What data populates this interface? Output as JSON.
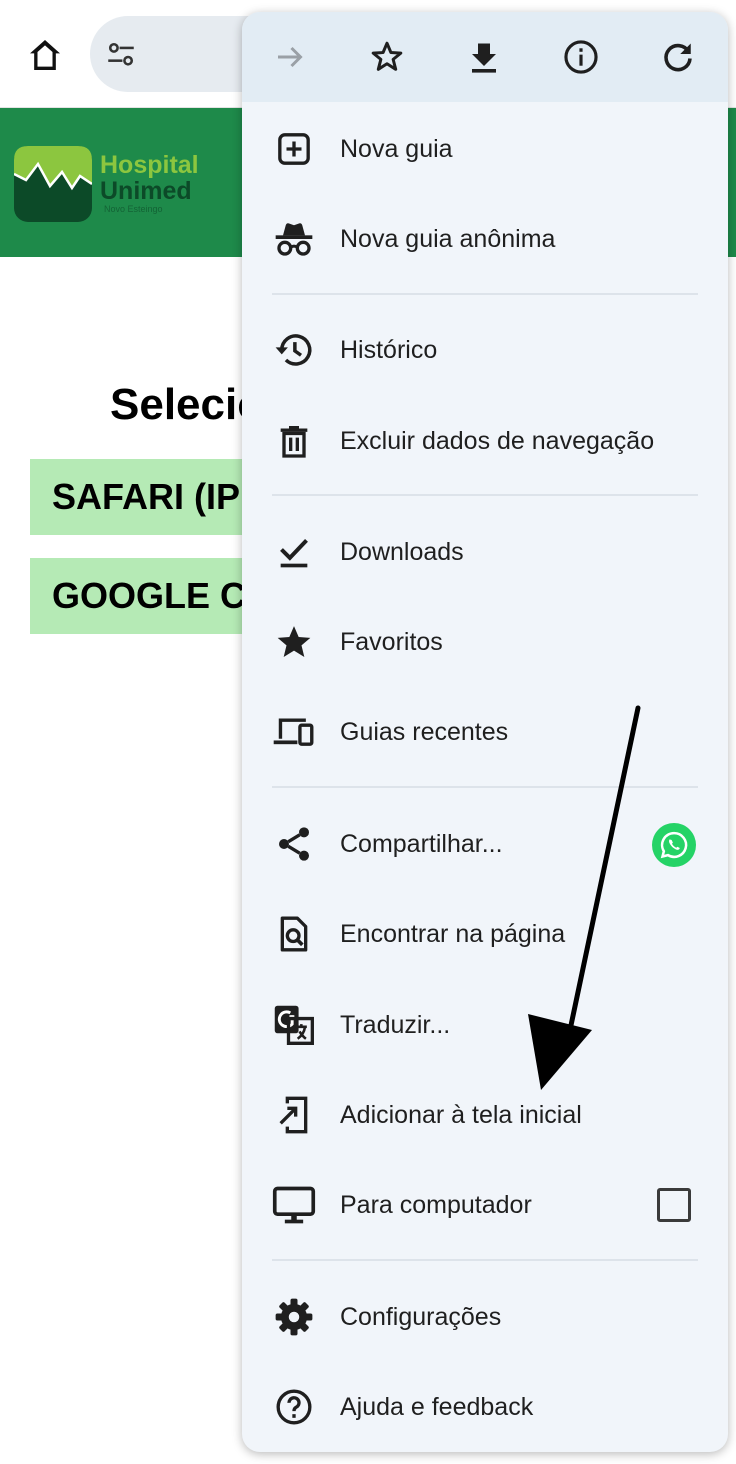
{
  "toolbar": {
    "icons": [
      "home-icon",
      "tune-icon"
    ]
  },
  "site": {
    "logo_line1": "Hospital",
    "logo_line2": "Unimed",
    "logo_line3": "Novo Esteingo",
    "brand_color": "#1e8a4a",
    "heading": "Selecio",
    "options": [
      "SAFARI (IP",
      "GOOGLE C"
    ]
  },
  "menu": {
    "top_icons": [
      "forward-icon",
      "bookmark-star-icon",
      "download-icon",
      "info-icon",
      "refresh-icon"
    ],
    "items": [
      {
        "label": "Nova guia",
        "icon": "new-tab-icon"
      },
      {
        "label": "Nova guia anônima",
        "icon": "incognito-icon"
      },
      {
        "label": "Histórico",
        "icon": "history-icon"
      },
      {
        "label": "Excluir dados de navegação",
        "icon": "trash-icon"
      },
      {
        "label": "Downloads",
        "icon": "downloads-check-icon"
      },
      {
        "label": "Favoritos",
        "icon": "star-icon"
      },
      {
        "label": "Guias recentes",
        "icon": "devices-icon"
      },
      {
        "label": "Compartilhar...",
        "icon": "share-icon"
      },
      {
        "label": "Encontrar na página",
        "icon": "find-in-page-icon"
      },
      {
        "label": "Traduzir...",
        "icon": "translate-icon"
      },
      {
        "label": "Adicionar à tela inicial",
        "icon": "add-to-home-icon"
      },
      {
        "label": "Para computador",
        "icon": "desktop-icon"
      },
      {
        "label": "Configurações",
        "icon": "settings-icon"
      },
      {
        "label": "Ajuda e feedback",
        "icon": "help-icon"
      }
    ],
    "desktop_checked": false
  }
}
